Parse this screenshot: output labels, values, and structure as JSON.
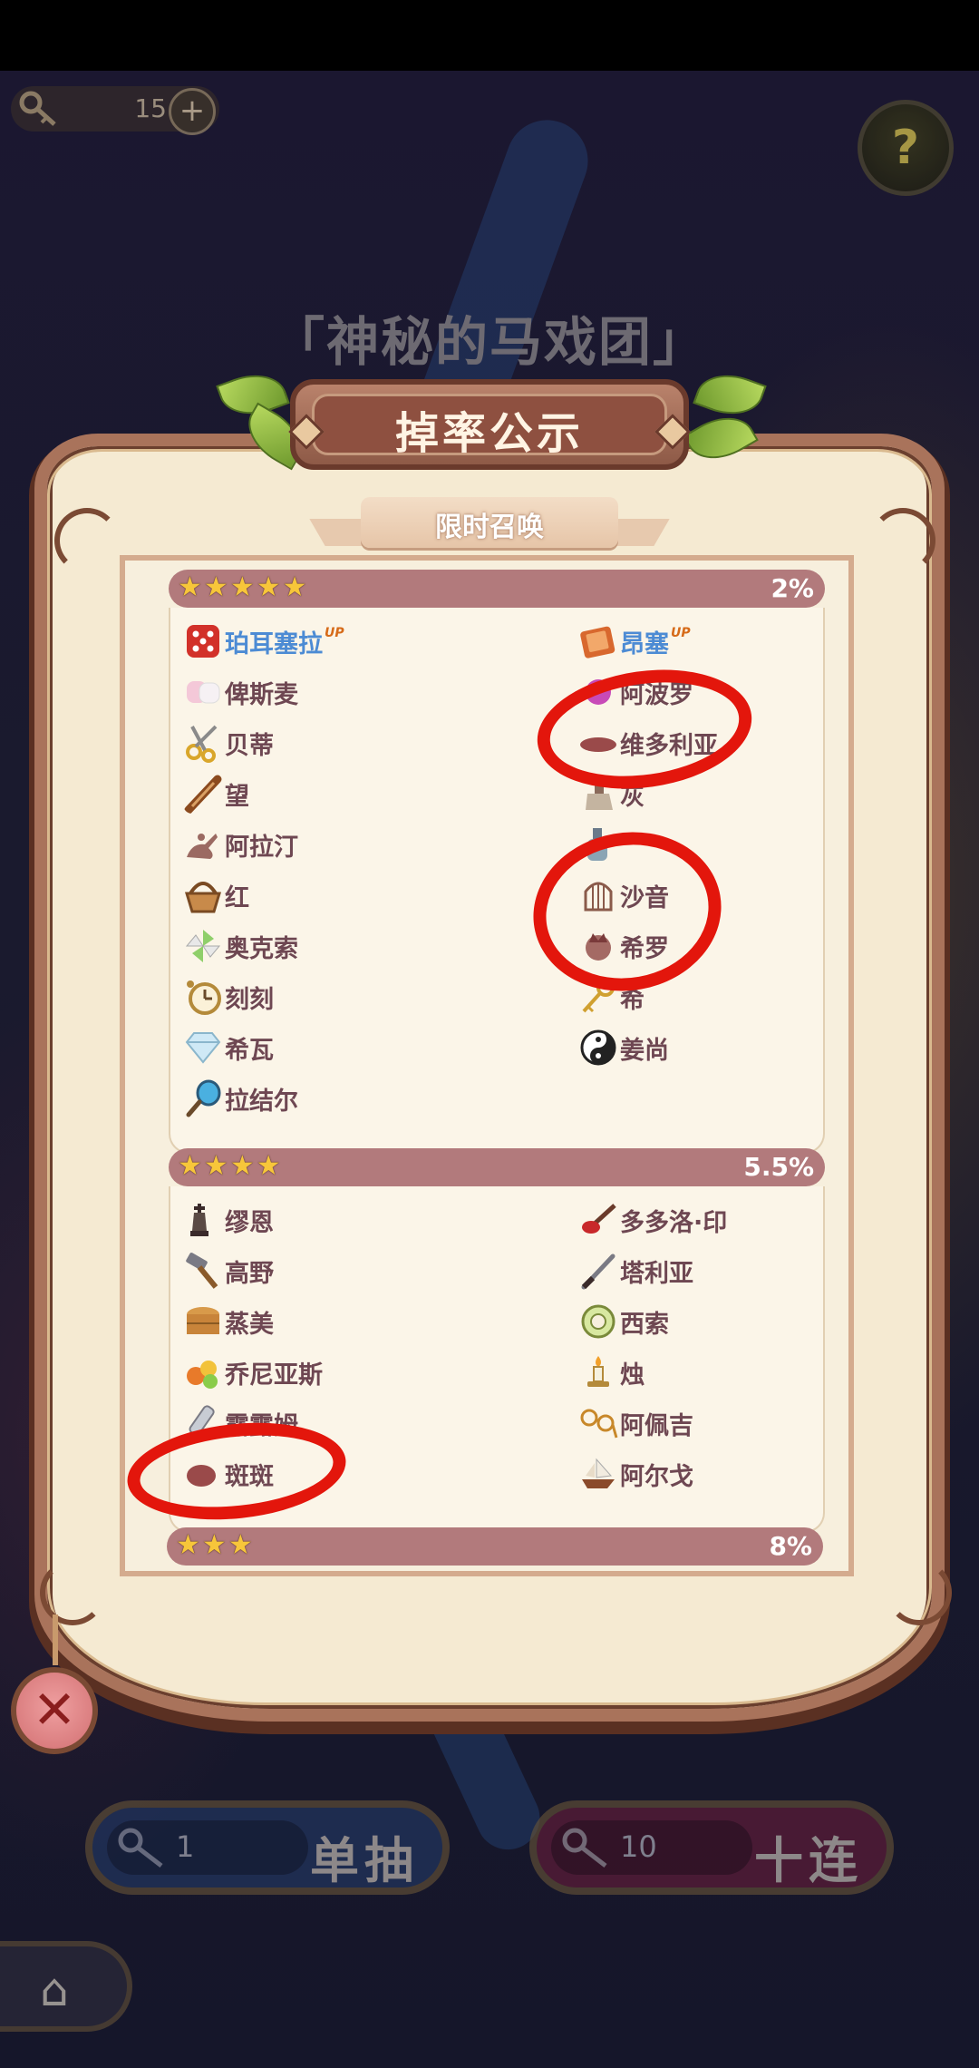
{
  "hud": {
    "key_count": "15",
    "plus": "+",
    "help": "?"
  },
  "banner_title": "「神秘的马戏团」",
  "panel": {
    "title": "掉率公示",
    "subtitle": "限时召唤"
  },
  "sections": [
    {
      "stars": 5,
      "rate": "2%",
      "left": [
        {
          "name": "珀耳塞拉",
          "up": "UP",
          "icon": "dice-icon"
        },
        {
          "name": "俾斯麦",
          "icon": "marshmallow-icon"
        },
        {
          "name": "贝蒂",
          "icon": "scissors-icon"
        },
        {
          "name": "望",
          "icon": "telescope-icon"
        },
        {
          "name": "阿拉汀",
          "icon": "genie-lamp-icon"
        },
        {
          "name": "红",
          "icon": "basket-icon"
        },
        {
          "name": "奥克索",
          "icon": "pinwheel-icon"
        },
        {
          "name": "刻刻",
          "icon": "pocket-watch-icon"
        },
        {
          "name": "希瓦",
          "icon": "diamond-icon"
        },
        {
          "name": "拉结尔",
          "icon": "mirror-icon"
        }
      ],
      "right": [
        {
          "name": "昂塞",
          "up": "UP",
          "icon": "book-icon"
        },
        {
          "name": "阿波罗",
          "icon": "gem-icon"
        },
        {
          "name": "维多利亚",
          "icon": "blob-icon"
        },
        {
          "name": "灰",
          "icon": "broom-icon"
        },
        {
          "name": "",
          "icon": "bottle-icon"
        },
        {
          "name": "沙音",
          "icon": "birdcage-icon"
        },
        {
          "name": "希罗",
          "icon": "crown-icon"
        },
        {
          "name": "希",
          "icon": "key-icon"
        },
        {
          "name": "姜尚",
          "icon": "yin-yang-icon"
        }
      ]
    },
    {
      "stars": 4,
      "rate": "5.5%",
      "left": [
        {
          "name": "缪恩",
          "icon": "chess-king-icon"
        },
        {
          "name": "高野",
          "icon": "hammer-icon"
        },
        {
          "name": "蒸美",
          "icon": "steamer-icon"
        },
        {
          "name": "乔尼亚斯",
          "icon": "fruit-icon"
        },
        {
          "name": "露露姆",
          "icon": "syringe-icon"
        },
        {
          "name": "斑斑",
          "icon": "blob-icon"
        }
      ],
      "right": [
        {
          "name": "多多洛·印",
          "icon": "seal-stamp-icon"
        },
        {
          "name": "塔利亚",
          "icon": "knife-icon"
        },
        {
          "name": "西索",
          "icon": "tape-icon"
        },
        {
          "name": "烛",
          "icon": "candle-icon"
        },
        {
          "name": "阿佩吉",
          "icon": "glasses-icon"
        },
        {
          "name": "阿尔戈",
          "icon": "ship-icon"
        }
      ]
    },
    {
      "stars": 3,
      "rate": "8%"
    }
  ],
  "buttons": {
    "single": {
      "count": "1",
      "label": "单抽"
    },
    "ten": {
      "count": "10",
      "label": "十连"
    },
    "close": "✕",
    "home": "⌂"
  },
  "colors": {
    "panel_bg": "#f5ead2",
    "section_bar": "#b27a7c",
    "annotation_red": "#e3160c",
    "up_highlight": "#4c8bd4"
  }
}
